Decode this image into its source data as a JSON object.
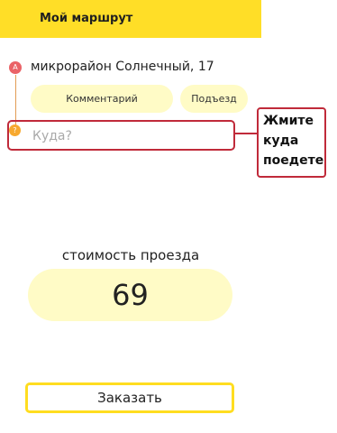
{
  "header": {
    "title": "Мой маршрут"
  },
  "route": {
    "from": {
      "marker": "A",
      "address": "микрорайон Солнечный, 17"
    },
    "comment_label": "Комментарий",
    "entrance_label": "Подъезд",
    "to": {
      "marker": "?",
      "placeholder": "Куда?",
      "value": ""
    }
  },
  "callout": {
    "text": "Жмите\nкуда\nпоедете"
  },
  "fare": {
    "label": "стоимость проезда",
    "value": "69"
  },
  "order_button": {
    "label": "Заказать"
  },
  "colors": {
    "accent": "#ffde27",
    "pill": "#fffbc6",
    "marker_a": "#ea6367",
    "marker_b": "#f7a930",
    "annotation": "#c02a3a"
  }
}
